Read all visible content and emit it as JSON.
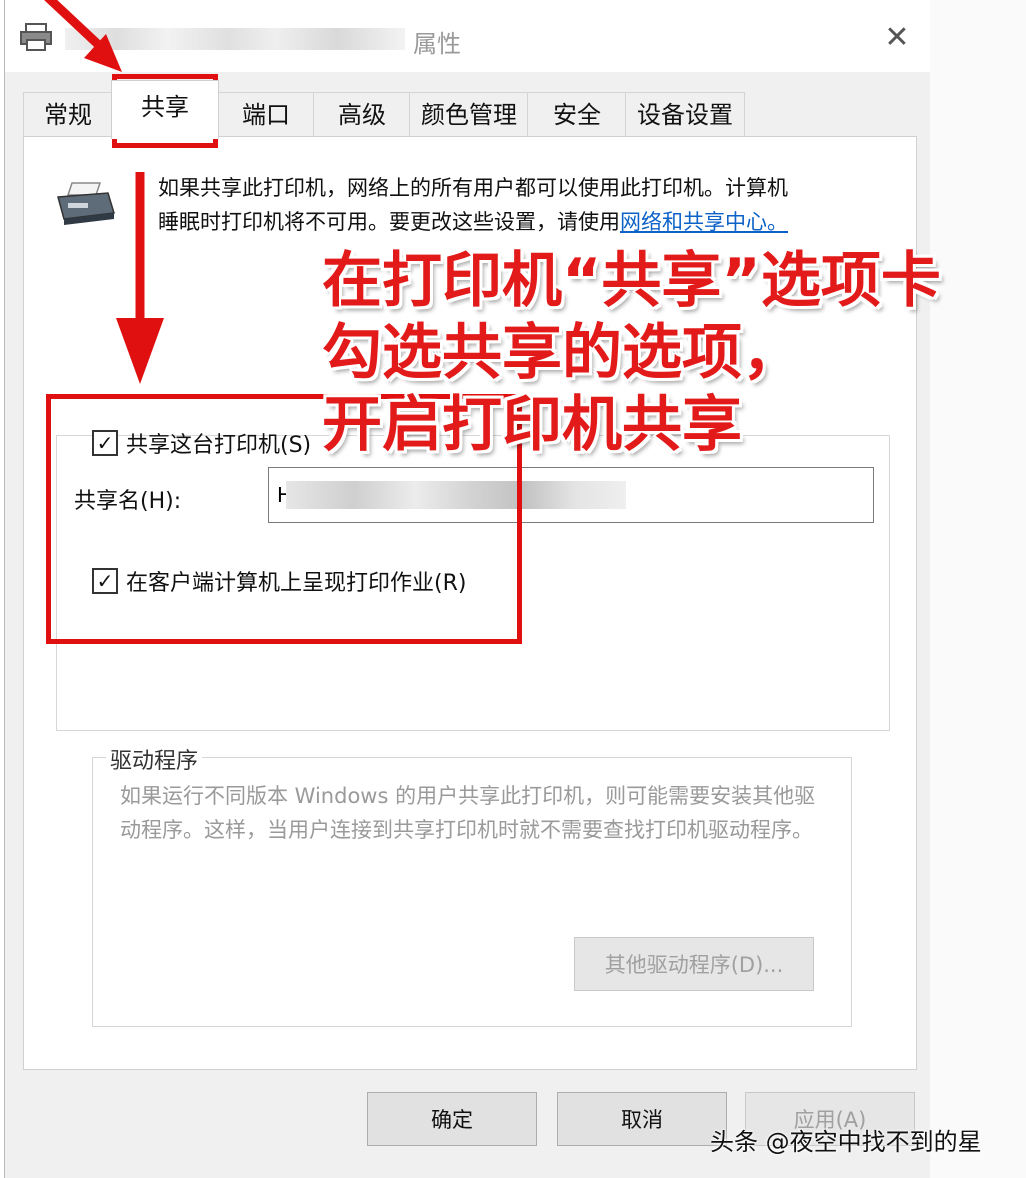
{
  "window": {
    "title": "属性",
    "close_glyph": "✕"
  },
  "tabs": [
    {
      "label": "常规",
      "active": false
    },
    {
      "label": "共享",
      "active": true
    },
    {
      "label": "端口",
      "active": false
    },
    {
      "label": "高级",
      "active": false
    },
    {
      "label": "颜色管理",
      "active": false
    },
    {
      "label": "安全",
      "active": false
    },
    {
      "label": "设备设置",
      "active": false
    }
  ],
  "sharing": {
    "description_1": "如果共享此打印机，网络上的所有用户都可以使用此打印机。计算机",
    "description_2": "睡眠时打印机将不可用。要更改这些设置，请使用",
    "description_link": "网络和共享中心。",
    "share_checkbox_label": "共享这台打印机(S)",
    "share_checked": true,
    "share_name_label": "共享名(H):",
    "share_name_value": "H",
    "render_checkbox_label": "在客户端计算机上呈现打印作业(R)",
    "render_checked": true
  },
  "drivers": {
    "legend": "驱动程序",
    "text": "如果运行不同版本 Windows 的用户共享此打印机，则可能需要安装其他驱动程序。这样，当用户连接到共享打印机时就不需要查找打印机驱动程序。",
    "additional_button": "其他驱动程序(D)..."
  },
  "footer": {
    "ok": "确定",
    "cancel": "取消",
    "apply": "应用(A)"
  },
  "annotation": {
    "line_1": "在打印机“共享”选项卡",
    "line_2": "勾选共享的选项，",
    "line_3": "开启打印机共享",
    "color": "#e01010"
  },
  "watermark": "头条 @夜空中找不到的星"
}
